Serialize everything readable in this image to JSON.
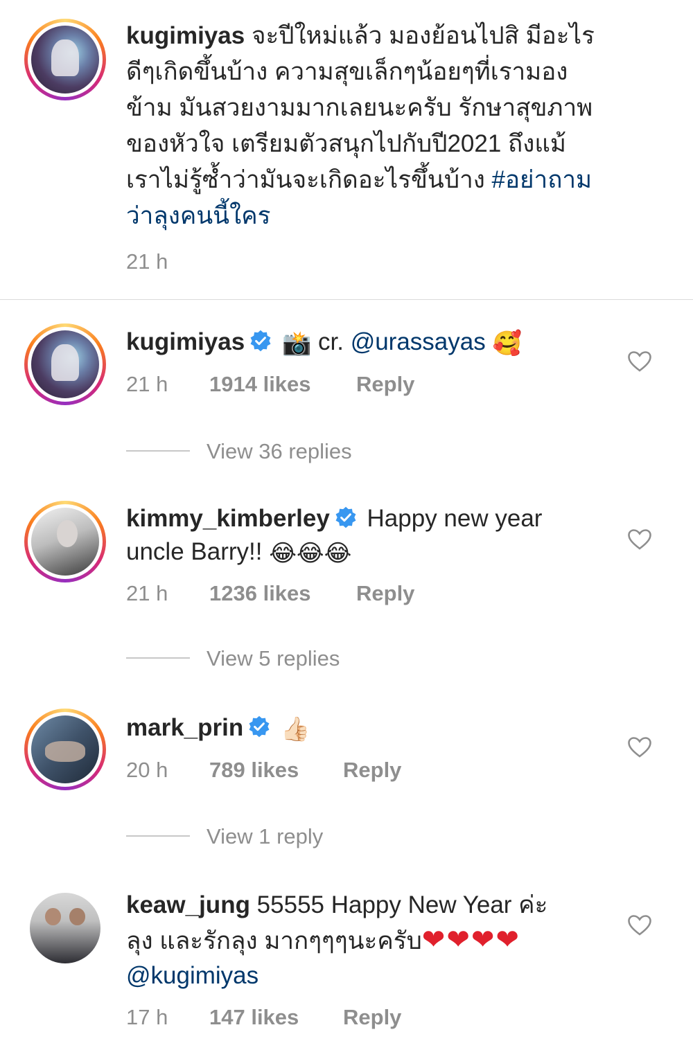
{
  "caption": {
    "username": "kugimiyas",
    "text_lines": [
      "จะปีใหม่แล้ว มองย้อนไปสิ มีอะไร",
      "ดีๆเกิดขึ้นบ้าง ความสุขเล็กๆน้อยๆที่เรามอง",
      "ข้าม มันสวยงามมากเลยนะครับ รักษาสุขภาพ",
      "ของหัวใจ เตรียมตัวสนุกไปกับปี2021 ถึงแม้",
      "เราไม่รู้ซ้ำว่ามันจะเกิดอะไรขึ้นบ้าง "
    ],
    "hashtag_part1": "#อย่าถาม",
    "hashtag_part2": "ว่าลุงคนนี้ใคร",
    "time": "21 h"
  },
  "comments": [
    {
      "username": "kugimiyas",
      "verified": true,
      "emoji_prefix": "📸",
      "text": " cr. ",
      "mention": "@urassayas",
      "emoji_suffix": "🥰",
      "time": "21 h",
      "likes": "1914 likes",
      "reply": "Reply",
      "view_replies": "View 36 replies",
      "avatar_icon": "space-character-avatar"
    },
    {
      "username": "kimmy_kimberley",
      "verified": true,
      "text_line1": "Happy new year",
      "text_line2": "uncle Barry!! ",
      "emoji_suffix": "😂😂😂",
      "time": "21 h",
      "likes": "1236 likes",
      "reply": "Reply",
      "view_replies": "View 5 replies",
      "avatar_icon": "portrait-avatar"
    },
    {
      "username": "mark_prin",
      "verified": true,
      "emoji_suffix": "👍🏻",
      "time": "20 h",
      "likes": "789 likes",
      "reply": "Reply",
      "view_replies": "View 1 reply",
      "avatar_icon": "sleeping-man-avatar"
    },
    {
      "username": "keaw_jung",
      "verified": false,
      "text_line1": " 55555 Happy New Year ค่ะ",
      "text_line2": "ลุง และรักลุง มากๆๆๆนะครับ",
      "hearts": "❤❤❤❤",
      "mention": "@kugimiyas",
      "time": "17 h",
      "likes": "147 likes",
      "reply": "Reply",
      "avatar_icon": "graduation-photo-avatar"
    }
  ],
  "colors": {
    "text": "#262626",
    "secondary": "#8e8e8e",
    "link": "#00376b",
    "verified": "#3897f0",
    "divider": "#dbdbdb"
  }
}
